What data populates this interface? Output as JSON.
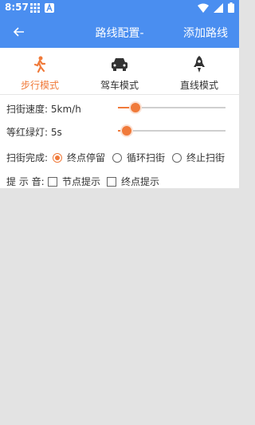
{
  "status": {
    "time": "8:57"
  },
  "header": {
    "title": "路线配置-",
    "action": "添加路线"
  },
  "modes": [
    {
      "label": "步行模式",
      "active": true
    },
    {
      "label": "驾车模式",
      "active": false
    },
    {
      "label": "直线模式",
      "active": false
    }
  ],
  "speed": {
    "label": "扫街速度:",
    "value": "5km/h",
    "level": 0.16
  },
  "light": {
    "label": "等红绿灯:",
    "value": "5s",
    "level": 0.08
  },
  "finish": {
    "label": "扫街完成:",
    "options": [
      "终点停留",
      "循环扫街",
      "终止扫街"
    ],
    "selected": 0
  },
  "sound": {
    "label": "提 示 音:",
    "options": [
      "节点提示",
      "终点提示"
    ]
  },
  "colors": {
    "accent": "#f07a3a",
    "primary": "#4a8ef0"
  }
}
